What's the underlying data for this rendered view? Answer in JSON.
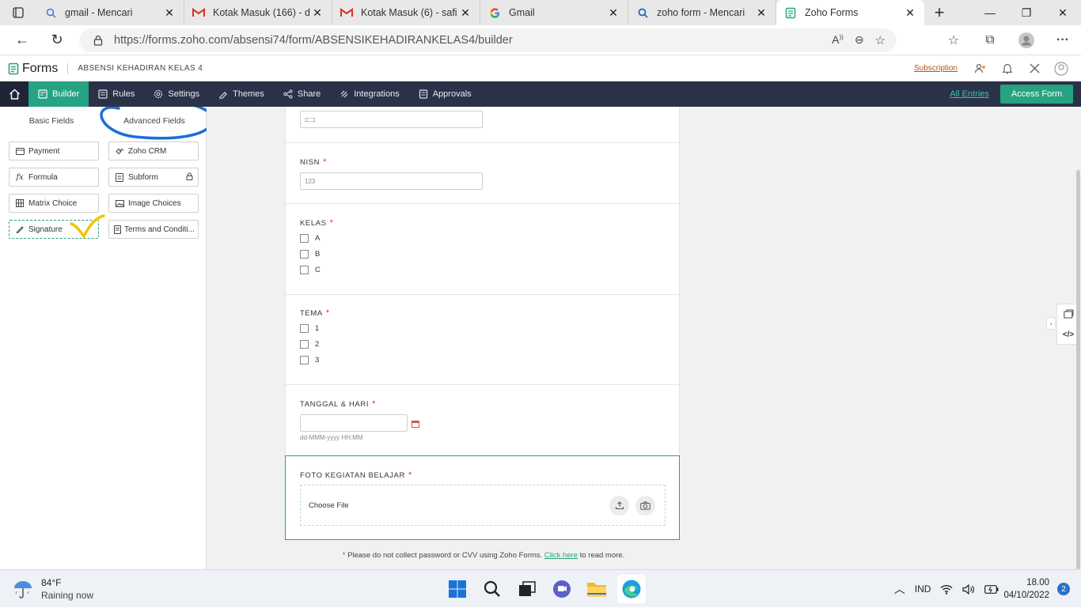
{
  "browser": {
    "tabs": [
      {
        "label": "gmail - Mencari",
        "icon": "search-icon"
      },
      {
        "label": "Kotak Masuk (166) - d",
        "icon": "gmail-icon"
      },
      {
        "label": "Kotak Masuk (6) - safi",
        "icon": "gmail-icon"
      },
      {
        "label": "Gmail",
        "icon": "google-icon"
      },
      {
        "label": "zoho form - Mencari",
        "icon": "search-icon"
      },
      {
        "label": "Zoho Forms",
        "icon": "zoho-forms-icon",
        "active": true
      }
    ],
    "url": "https://forms.zoho.com/absensi74/form/ABSENSIKEHADIRANKELAS4/builder"
  },
  "app": {
    "logo_text": "Forms",
    "form_name": "ABSENSI KEHADIRAN KELAS 4",
    "subscription_label": "Subscription"
  },
  "nav": {
    "items": [
      {
        "label": "Builder",
        "active": true
      },
      {
        "label": "Rules"
      },
      {
        "label": "Settings"
      },
      {
        "label": "Themes"
      },
      {
        "label": "Share"
      },
      {
        "label": "Integrations"
      },
      {
        "label": "Approvals"
      }
    ],
    "all_entries": "All Entries",
    "access_form": "Access Form"
  },
  "sidebar": {
    "tabs": [
      "Basic Fields",
      "Advanced Fields"
    ],
    "fields": [
      {
        "label": "Payment",
        "icon": "payment-icon"
      },
      {
        "label": "Zoho CRM",
        "icon": "crm-icon"
      },
      {
        "label": "Formula",
        "icon": "formula-icon"
      },
      {
        "label": "Subform",
        "icon": "subform-icon",
        "locked": true
      },
      {
        "label": "Matrix Choice",
        "icon": "matrix-icon"
      },
      {
        "label": "Image Choices",
        "icon": "image-icon"
      },
      {
        "label": "Signature",
        "icon": "signature-icon",
        "selected": true
      },
      {
        "label": "Terms and Conditi...",
        "icon": "terms-icon"
      }
    ]
  },
  "form": {
    "top_input_placeholder": "⊏⊐",
    "nisn": {
      "label": "NISN",
      "placeholder": "123"
    },
    "kelas": {
      "label": "KELAS",
      "options": [
        "A",
        "B",
        "C"
      ]
    },
    "tema": {
      "label": "TEMA",
      "options": [
        "1",
        "2",
        "3"
      ]
    },
    "tanggal": {
      "label": "TANGGAL & HARI",
      "hint": "dd-MMM-yyyy HH:MM"
    },
    "foto": {
      "label": "FOTO KEGIATAN BELAJAR",
      "choose_file": "Choose File"
    },
    "required_mark": "*"
  },
  "footnote": {
    "star": "*",
    "text": "Please do not collect password or CVV using Zoho Forms.",
    "link": "Click here",
    "suffix": "to read more."
  },
  "taskbar": {
    "temp": "84°F",
    "weather": "Raining now",
    "lang": "IND",
    "time": "18.00",
    "date": "04/10/2022",
    "notifications": "2"
  },
  "colors": {
    "accent": "#26a382",
    "nav_bg": "#2b3247",
    "required": "#e0362c",
    "annotation_blue": "#1a6fd6",
    "annotation_yellow": "#f2c400"
  }
}
